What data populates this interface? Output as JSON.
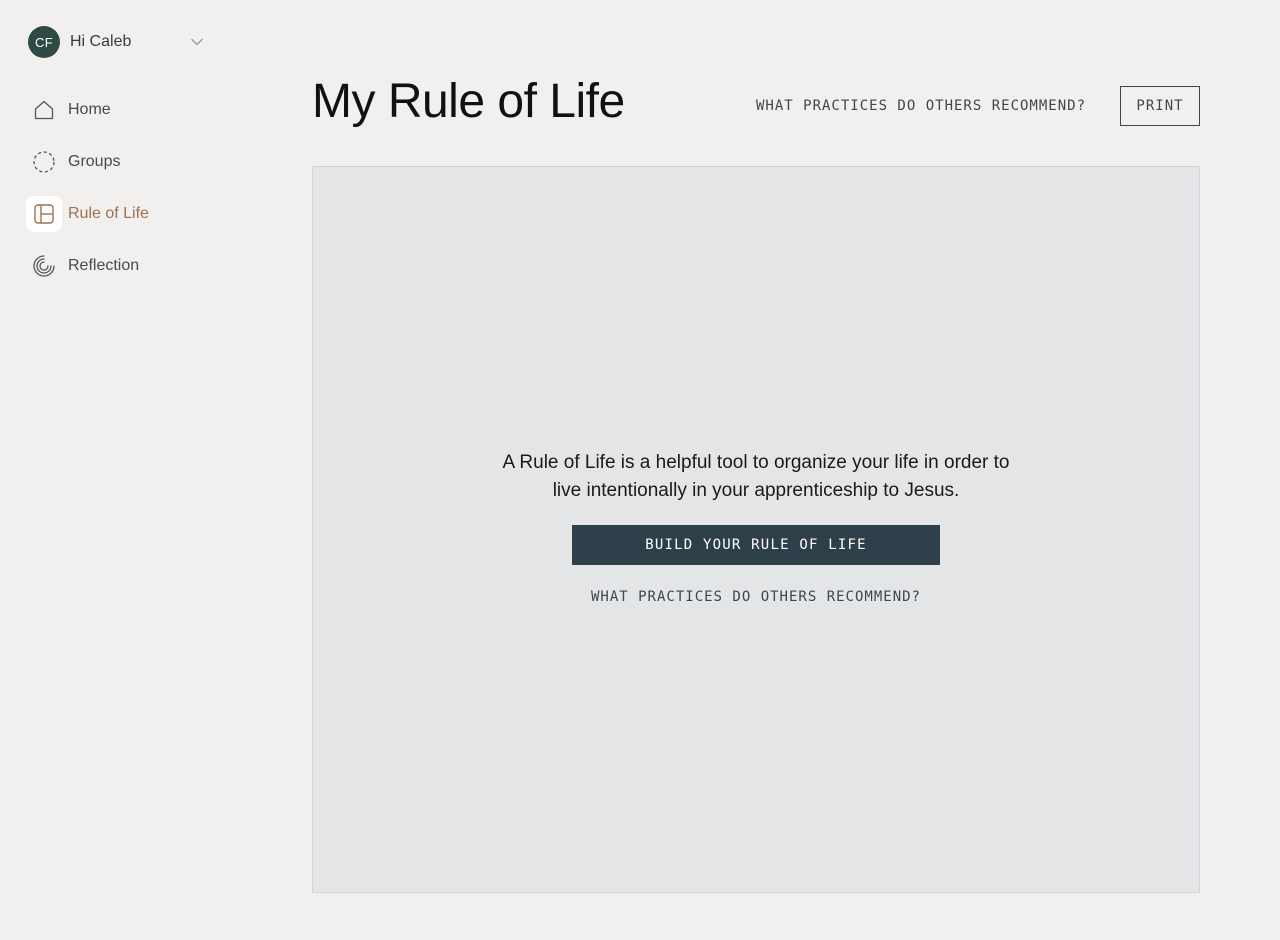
{
  "user": {
    "initials": "CF",
    "greeting": "Hi Caleb",
    "avatar_color": "#2f4a45",
    "menu_icon": "chevron-down-icon"
  },
  "sidebar": {
    "items": [
      {
        "label": "Home",
        "icon": "home-icon",
        "active": false
      },
      {
        "label": "Groups",
        "icon": "dashed-circle-icon",
        "active": false
      },
      {
        "label": "Rule of Life",
        "icon": "layout-icon",
        "active": true
      },
      {
        "label": "Reflection",
        "icon": "spiral-icon",
        "active": false
      }
    ],
    "active_color": "#a0714f"
  },
  "header": {
    "title": "My Rule of Life",
    "recommend_link": "WHAT PRACTICES DO OTHERS RECOMMEND?",
    "print_label": "PRINT"
  },
  "main": {
    "intro": "A Rule of Life is a helpful tool to organize your life in order to live intentionally in your apprenticeship to Jesus.",
    "build_button": "BUILD YOUR RULE OF LIFE",
    "recommend_link": "WHAT PRACTICES DO OTHERS RECOMMEND?",
    "button_color": "#2f3f4a"
  }
}
